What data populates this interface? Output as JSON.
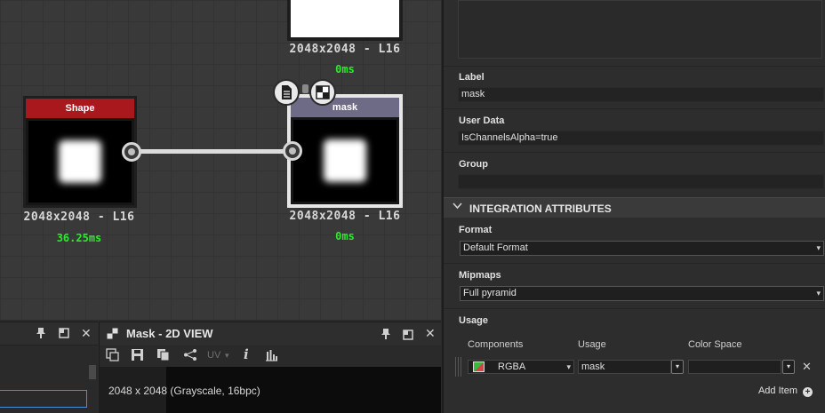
{
  "graph": {
    "top_node": {
      "stats": "2048x2048 - L16",
      "time": "0ms"
    },
    "shape_node": {
      "title": "Shape",
      "stats": "2048x2048 - L16",
      "time": "36.25ms"
    },
    "mask_node": {
      "title": "mask",
      "stats": "2048x2048 - L16",
      "time": "0ms"
    }
  },
  "view2d": {
    "title": "Mask - 2D VIEW",
    "uv_label": "UV",
    "info_label": "i",
    "image_info": "2048 x 2048 (Grayscale, 16bpc)"
  },
  "properties": {
    "label": {
      "label": "Label",
      "value": "mask"
    },
    "user_data": {
      "label": "User Data",
      "value": "IsChannelsAlpha=true"
    },
    "group": {
      "label": "Group",
      "value": ""
    },
    "integration_section": "INTEGRATION ATTRIBUTES",
    "format": {
      "label": "Format",
      "value": "Default Format"
    },
    "mipmaps": {
      "label": "Mipmaps",
      "value": "Full pyramid"
    },
    "usage": {
      "label": "Usage",
      "columns": [
        "Components",
        "Usage",
        "Color Space"
      ],
      "rows": [
        {
          "components": "RGBA",
          "usage": "mask",
          "color_space": ""
        }
      ],
      "add_item": "Add Item"
    }
  },
  "icons": {
    "pin": "pin-icon",
    "maximize": "maximize-icon",
    "close": "close-icon",
    "view2d": "view-2d-icon",
    "plus": "plus-circle-icon"
  }
}
